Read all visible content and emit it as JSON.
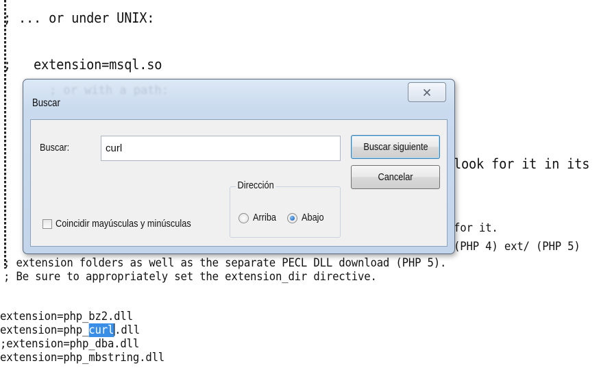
{
  "editor": {
    "lines": [
      "; ... or under UNIX:",
      ";",
      ";   extension=msql.so",
      ";",
      ";",
      "look for it in its",
      "for it.",
      "(PHP 4) ext/ (PHP 5)",
      "; extension folders as well as the separate PECL DLL download (PHP 5).",
      "; Be sure to appropriately set the extension_dir directive.",
      "extension=php_bz2.dll",
      "extension=php_",
      "curl",
      ".dll",
      ";extension=php_dba.dll",
      "extension=php_mbstring.dll"
    ],
    "ghost_under_title": "; or with a path:"
  },
  "dialog": {
    "title": "Buscar",
    "close_glyph": "X",
    "find_label": "Buscar:",
    "find_value": "curl",
    "find_next_button": "Buscar siguiente",
    "cancel_button": "Cancelar",
    "match_case_label": "Coincidir mayúsculas y minúsculas",
    "direction_label": "Dirección",
    "direction_up": "Arriba",
    "direction_down": "Abajo",
    "direction_selected": "Abajo"
  }
}
